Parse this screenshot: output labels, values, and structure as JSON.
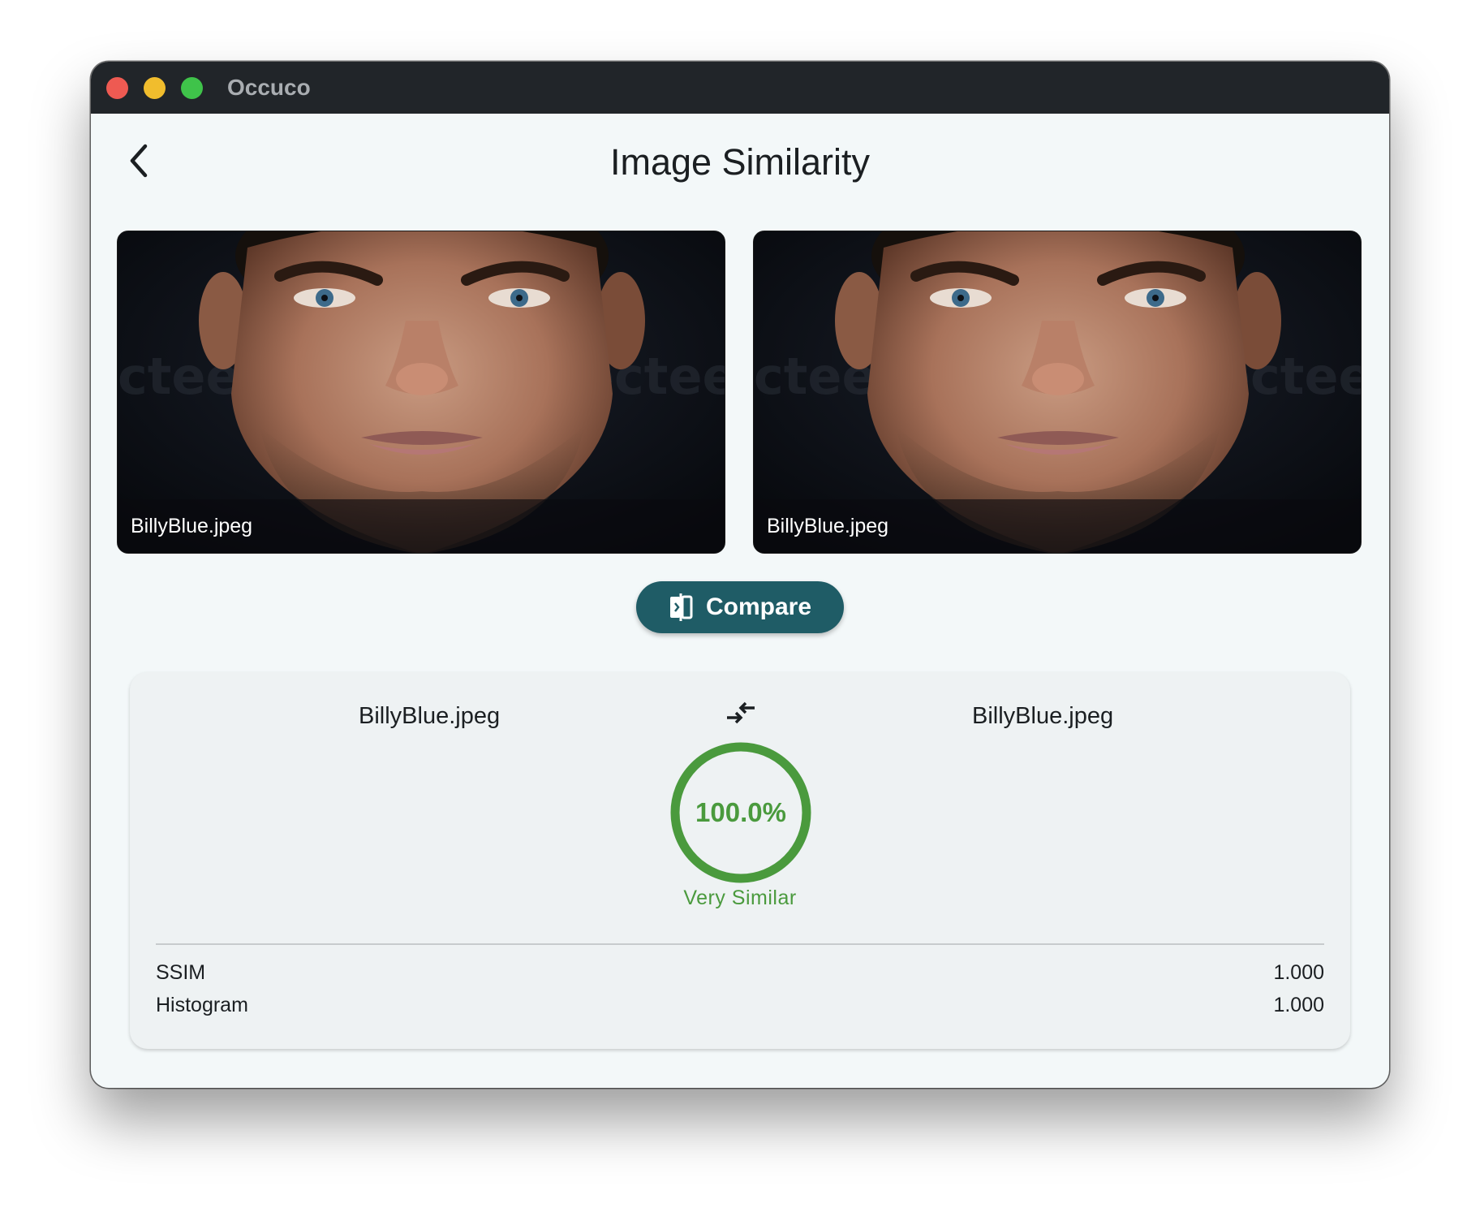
{
  "window": {
    "app_title": "Occuco"
  },
  "header": {
    "back_icon": "chevron-left-icon",
    "title": "Image Similarity"
  },
  "images": [
    {
      "filename": "BillyBlue.jpeg"
    },
    {
      "filename": "BillyBlue.jpeg"
    }
  ],
  "compare_button": {
    "icon": "compare-icon",
    "label": "Compare"
  },
  "result": {
    "left_filename": "BillyBlue.jpeg",
    "right_filename": "BillyBlue.jpeg",
    "swap_icon": "swap-arrows-icon",
    "similarity_percent": "100.0%",
    "similarity_fraction": 1.0,
    "verdict": "Very Similar",
    "metrics": [
      {
        "label": "SSIM",
        "value": "1.000"
      },
      {
        "label": "Histogram",
        "value": "1.000"
      }
    ]
  },
  "colors": {
    "titlebar": "#212529",
    "window_bg": "#f3f8f9",
    "accent_button": "#1f5c66",
    "success": "#4a9a3d",
    "card_bg": "#eef2f3"
  }
}
